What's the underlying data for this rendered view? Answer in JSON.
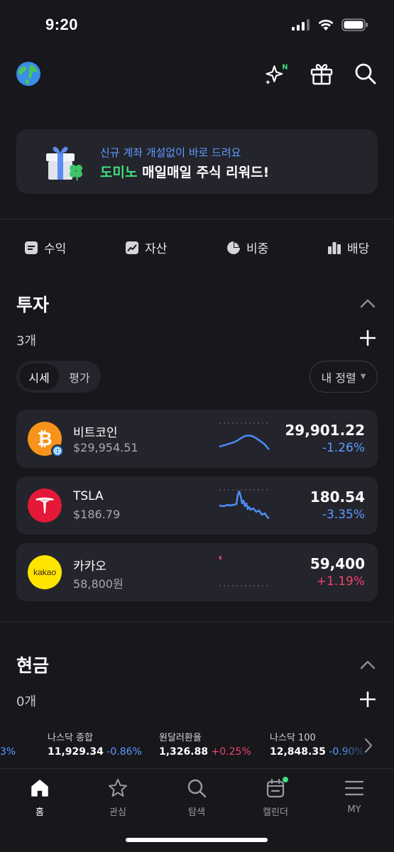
{
  "status_bar": {
    "time": "9:20"
  },
  "promo": {
    "subtitle": "신규 계좌 개설없이 바로 드려요",
    "title_highlight": "도미노",
    "title_rest": " 매일매일 주식 리워드!"
  },
  "summary_tabs": [
    {
      "label": "수익",
      "icon": "document-icon"
    },
    {
      "label": "자산",
      "icon": "chart-trend-icon"
    },
    {
      "label": "비중",
      "icon": "pie-chart-icon"
    },
    {
      "label": "배당",
      "icon": "bar-chart-icon"
    }
  ],
  "invest": {
    "title": "투자",
    "count": "3개",
    "segment": {
      "active": "시세",
      "inactive": "평가"
    },
    "sort_label": "내 정렬",
    "items": [
      {
        "name": "비트코인",
        "sub": "$29,954.51",
        "price": "29,901.22",
        "change": "-1.26%",
        "direction": "down",
        "logo": "bitcoin-logo"
      },
      {
        "name": "TSLA",
        "sub": "$186.79",
        "price": "180.54",
        "change": "-3.35%",
        "direction": "down",
        "logo": "tesla-logo"
      },
      {
        "name": "카카오",
        "sub": "58,800원",
        "price": "59,400",
        "change": "+1.19%",
        "direction": "up",
        "logo": "kakao-logo",
        "logo_text": "kakao"
      }
    ]
  },
  "cash": {
    "title": "현금",
    "count": "0개"
  },
  "ticker": {
    "partial_left": "3%",
    "items": [
      {
        "name": "나스닥 종합",
        "value": "11,929.34",
        "change": "-0.86%",
        "direction": "down"
      },
      {
        "name": "원달러환율",
        "value": "1,326.88",
        "change": "+0.25%",
        "direction": "up"
      },
      {
        "name": "나스닥 100",
        "value": "12,848.35",
        "change": "-0.90%",
        "direction": "down"
      }
    ]
  },
  "bottom_nav": [
    {
      "label": "홈",
      "icon": "home-icon",
      "active": true
    },
    {
      "label": "관심",
      "icon": "star-icon",
      "active": false
    },
    {
      "label": "탐색",
      "icon": "search-icon",
      "active": false
    },
    {
      "label": "캘린더",
      "icon": "calendar-icon",
      "active": false
    },
    {
      "label": "MY",
      "icon": "menu-icon",
      "active": false
    }
  ],
  "colors": {
    "background": "#17171c",
    "card": "#24242c",
    "accent_blue": "#5c9cff",
    "down_blue": "#5c9cff",
    "up_red": "#f0456a",
    "highlight_green": "#3ee07f",
    "new_badge_green": "#3ee07f"
  }
}
